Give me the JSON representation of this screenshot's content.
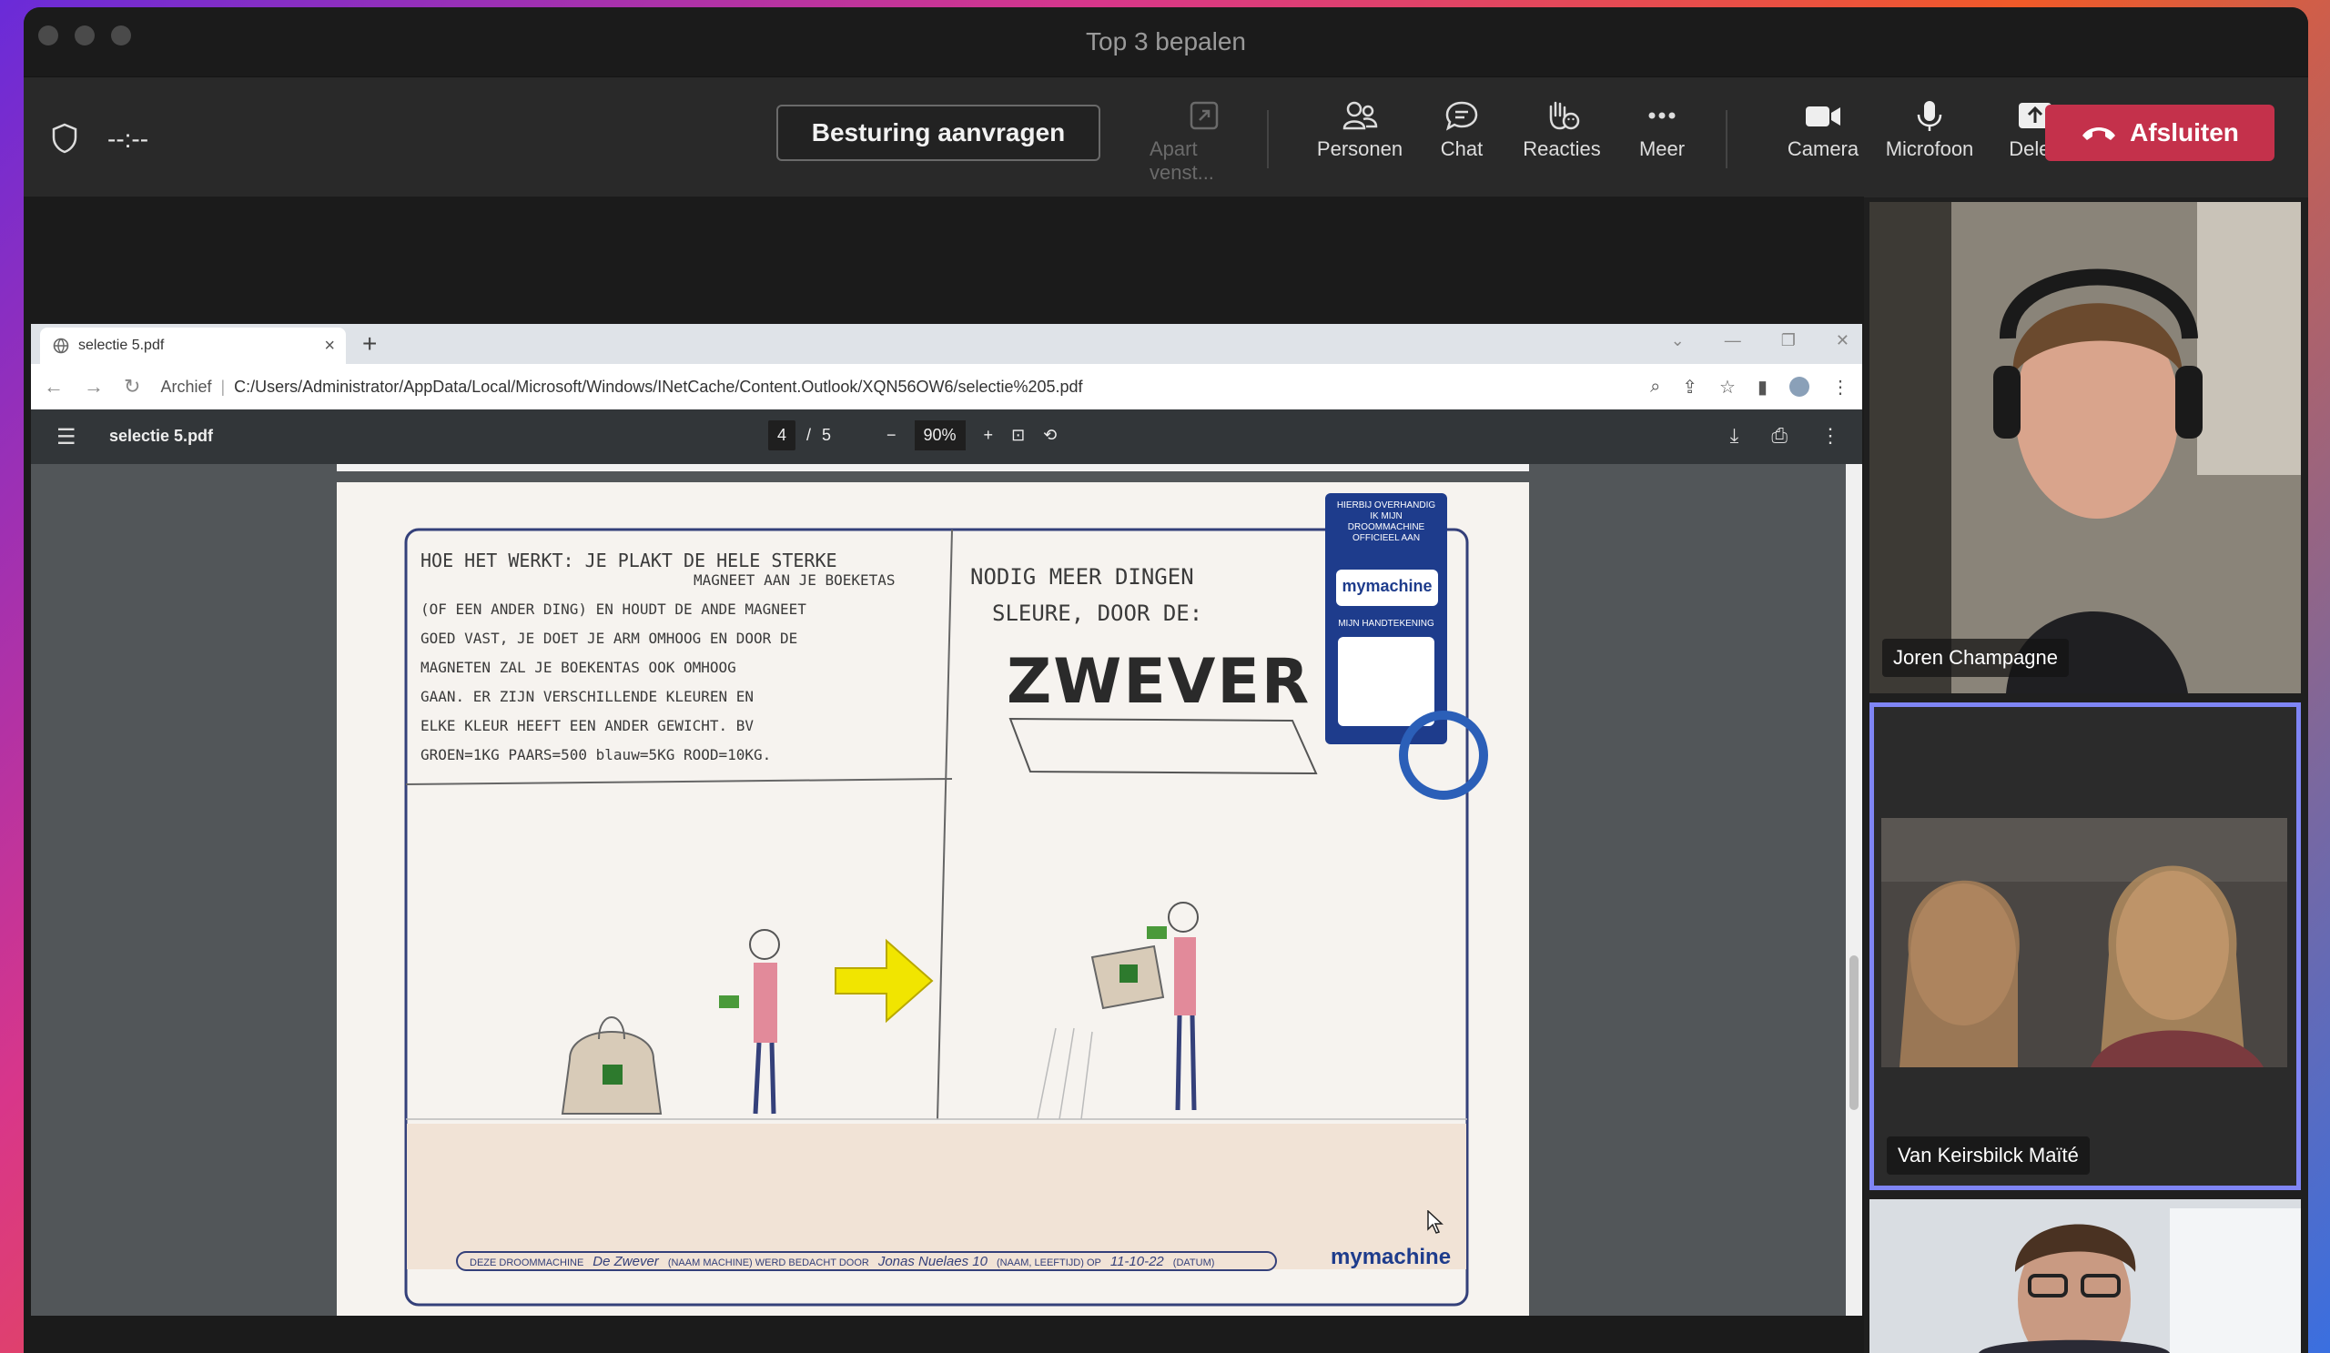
{
  "window": {
    "title": "Top 3 bepalen"
  },
  "toolbar": {
    "timer": "--:--",
    "request_control": "Besturing aanvragen",
    "popout": "Apart venst...",
    "people": "Personen",
    "chat": "Chat",
    "reactions": "Reacties",
    "more": "Meer",
    "camera": "Camera",
    "microphone": "Microfoon",
    "share": "Delen",
    "leave": "Afsluiten"
  },
  "browser": {
    "tab_title": "selectie 5.pdf",
    "address_label": "Archief",
    "url": "C:/Users/Administrator/AppData/Local/Microsoft/Windows/INetCache/Content.Outlook/XQN56OW6/selectie%205.pdf"
  },
  "pdf": {
    "file_name": "selectie 5.pdf",
    "current_page": "4",
    "page_separator": "/",
    "total_pages": "5",
    "zoom": "90%"
  },
  "drawing": {
    "left_text": [
      "HOE HET WERKT: JE PLAKT DE HELE STERKE",
      "MAGNEET AAN JE BOEKETAS",
      "(OF EEN ANDER DING) EN HOUDT DE ANDE MAGNEET",
      "GOED VAST, JE DOET JE ARM OMHOOG EN DOOR DE",
      "MAGNETEN ZAL JE BOEKENTAS OOK OMHOOG",
      "GAAN. ER ZIJN VERSCHILLENDE KLEUREN EN",
      "ELKE KLEUR HEEFT EEN ANDER GEWICHT. BV",
      "GROEN=1KG PAARS=500 blauw=5KG ROOD=10KG."
    ],
    "right_text": [
      "NODIG MEER DINGEN",
      "SLEURE, DOOR DE:"
    ],
    "machine_name": "ZWEVER",
    "stamp_top": "HIERBIJ OVERHANDIG IK MIJN DROOMMACHINE OFFICIEEL AAN",
    "stamp_brand": "mymachine",
    "stamp_sign": "MIJN HANDTEKENING",
    "footer_label1": "DEZE DROOMMACHINE",
    "footer_value1": "De Zwever",
    "footer_label2": "(NAAM MACHINE) WERD BEDACHT DOOR",
    "footer_value2": "Jonas Nuelaes 10",
    "footer_label3": "(NAAM, LEEFTIJD) OP",
    "footer_value3": "11-10-22",
    "footer_label4": "(DATUM)",
    "footer_brand": "mymachine"
  },
  "participants": [
    {
      "name": "Joren Champagne"
    },
    {
      "name": "Van Keirsbilck Maïté"
    }
  ],
  "colors": {
    "leave_red": "#c4314b",
    "active_border": "#7f85f5",
    "toolbar_bg": "#292929"
  }
}
